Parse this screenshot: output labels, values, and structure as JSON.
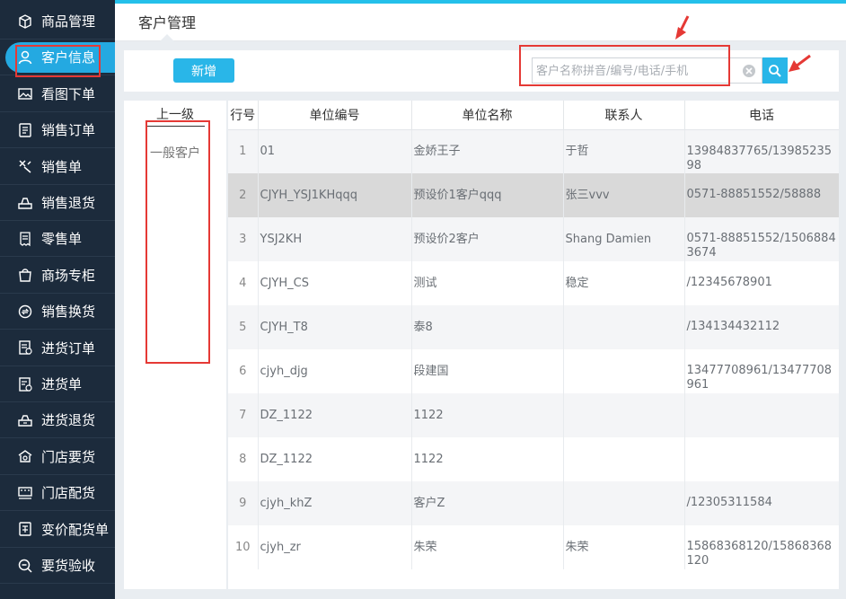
{
  "sidebar": {
    "items": [
      {
        "label": "商品管理",
        "icon": "box-icon"
      },
      {
        "label": "客户信息",
        "icon": "user-icon",
        "active": true
      },
      {
        "label": "看图下单",
        "icon": "image-icon"
      },
      {
        "label": "销售订单",
        "icon": "order-icon"
      },
      {
        "label": "销售单",
        "icon": "sale-icon"
      },
      {
        "label": "销售退货",
        "icon": "return-icon"
      },
      {
        "label": "零售单",
        "icon": "receipt-icon"
      },
      {
        "label": "商场专柜",
        "icon": "bag-icon"
      },
      {
        "label": "销售换货",
        "icon": "exchange-icon"
      },
      {
        "label": "进货订单",
        "icon": "purchase-order-icon"
      },
      {
        "label": "进货单",
        "icon": "purchase-icon"
      },
      {
        "label": "进货退货",
        "icon": "purchase-return-icon"
      },
      {
        "label": "门店要货",
        "icon": "store-icon"
      },
      {
        "label": "门店配货",
        "icon": "delivery-icon"
      },
      {
        "label": "变价配货单",
        "icon": "price-change-icon"
      },
      {
        "label": "要货验收",
        "icon": "inspect-icon"
      }
    ]
  },
  "header": {
    "tab_title": "客户管理"
  },
  "toolbar": {
    "add_label": "新增",
    "search_placeholder": "客户名称拼音/编号/电话/手机"
  },
  "category": {
    "header": "上一级",
    "items": [
      "一般客户"
    ]
  },
  "table": {
    "columns": [
      "行号",
      "单位编号",
      "单位名称",
      "联系人",
      "电话"
    ],
    "rows": [
      {
        "no": "1",
        "code": "01",
        "name": "金娇王子",
        "contact": "于哲",
        "phone": "13984837765/1398523598"
      },
      {
        "no": "2",
        "code": "CJYH_YSJ1KHqqq",
        "name": "预设价1客户qqq",
        "contact": "张三vvv",
        "phone": "0571-88851552/58888"
      },
      {
        "no": "3",
        "code": "YSJ2KH",
        "name": "预设价2客户",
        "contact": "Shang Damien",
        "phone": "0571-88851552/15068843674"
      },
      {
        "no": "4",
        "code": "CJYH_CS",
        "name": "测试",
        "contact": "稳定",
        "phone": "/12345678901"
      },
      {
        "no": "5",
        "code": "CJYH_T8",
        "name": "泰8",
        "contact": "",
        "phone": "/134134432112"
      },
      {
        "no": "6",
        "code": "cjyh_djg",
        "name": "段建国",
        "contact": "",
        "phone": "13477708961/13477708961"
      },
      {
        "no": "7",
        "code": "DZ_1122",
        "name": "1122",
        "contact": "",
        "phone": ""
      },
      {
        "no": "8",
        "code": "DZ_1122",
        "name": "1122",
        "contact": "",
        "phone": ""
      },
      {
        "no": "9",
        "code": "cjyh_khZ",
        "name": "客户Z",
        "contact": "",
        "phone": "/12305311584"
      },
      {
        "no": "10",
        "code": "cjyh_zr",
        "name": "朱荣",
        "contact": "朱荣",
        "phone": "15868368120/15868368120"
      }
    ]
  },
  "colors": {
    "sidebar_bg": "#1c2b3c",
    "accent": "#29b6e8",
    "annotation": "#e53935"
  }
}
